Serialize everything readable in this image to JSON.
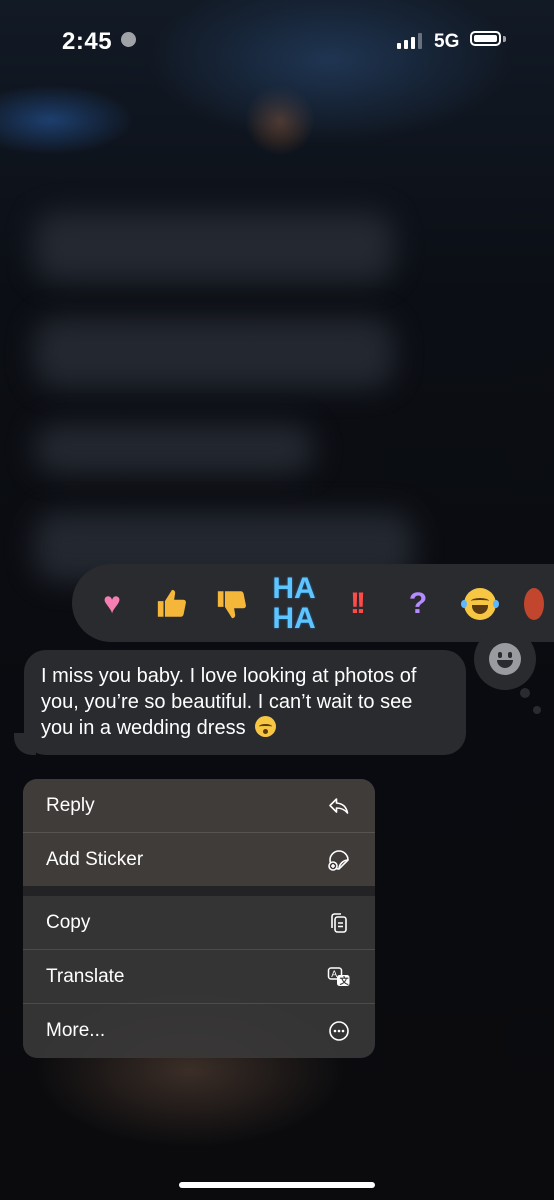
{
  "status_bar": {
    "time": "2:45",
    "network": "5G"
  },
  "tapbacks": [
    {
      "icon": "heart-reaction-icon"
    },
    {
      "icon": "thumbs-up-reaction-icon"
    },
    {
      "icon": "thumbs-down-reaction-icon"
    },
    {
      "icon": "haha-reaction-icon",
      "text_top": "HA",
      "text_bottom": "HA"
    },
    {
      "icon": "exclamation-reaction-icon"
    },
    {
      "icon": "question-reaction-icon"
    },
    {
      "icon": "laughing-emoji-reaction-icon"
    }
  ],
  "message": {
    "text": "I miss you baby. I love looking at photos of you, you’re so beautiful. I can’t wait to see you in a wedding dress",
    "trailing_emoji": "face-exhaling-emoji"
  },
  "menu": {
    "reply": "Reply",
    "add_sticker": "Add Sticker",
    "copy": "Copy",
    "translate": "Translate",
    "more": "More..."
  }
}
